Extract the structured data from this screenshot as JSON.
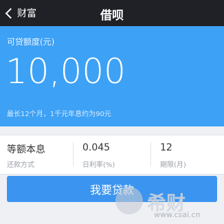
{
  "nav": {
    "back_label": "财富",
    "title": "借呗"
  },
  "hero": {
    "label": "可贷额度(元)",
    "amount": "10,000",
    "note": "最长12个月，1千元年息约为90元",
    "color": "#3da1f5"
  },
  "stats": [
    {
      "value": "等额本息",
      "label": "还款方式"
    },
    {
      "value": "0.045",
      "label": "日利率(%)"
    },
    {
      "value": "12",
      "label": "期限(月)"
    }
  ],
  "cta": {
    "label": "我要贷款",
    "color": "#3b95f0"
  },
  "watermark": {
    "text": "希财",
    "url": "www.csai.cn"
  }
}
